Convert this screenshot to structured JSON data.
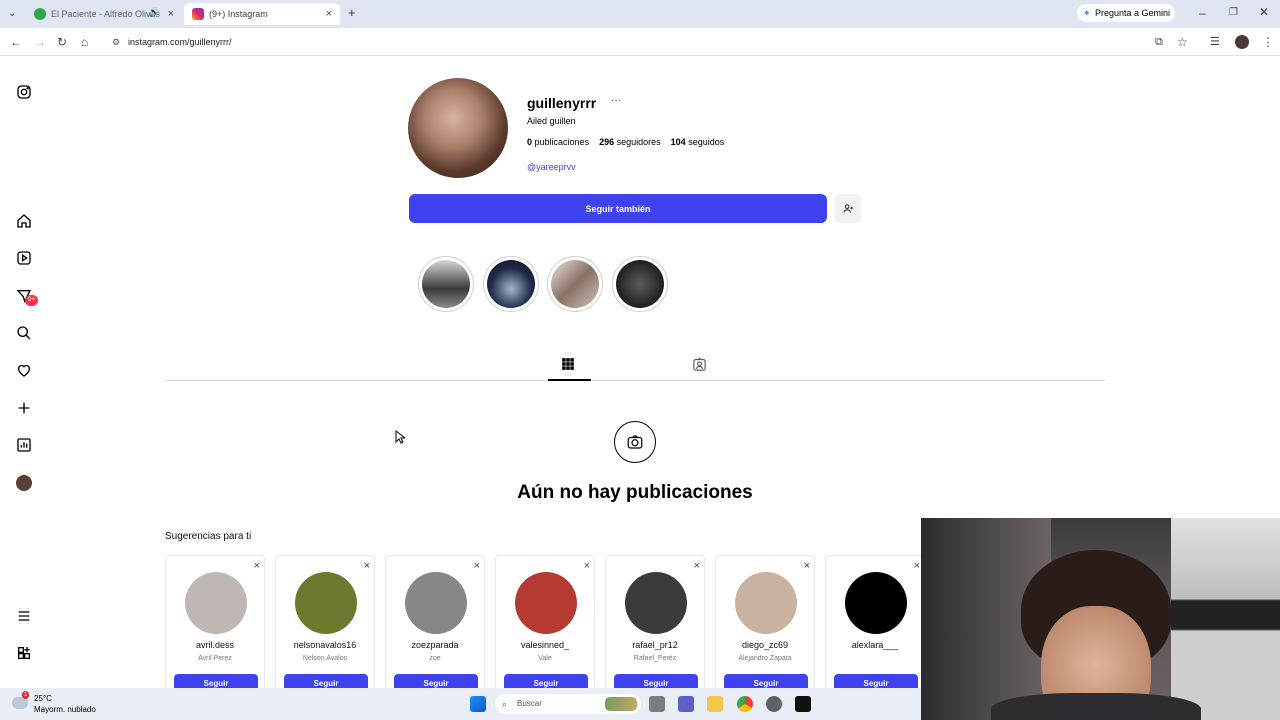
{
  "browser": {
    "tabs": [
      {
        "title": "El Paciente - Alfredo Olivas",
        "active": false
      },
      {
        "title": "(9+) Instagram",
        "active": true
      }
    ],
    "gemini_label": "Pregunta a Gemini",
    "url": "instagram.com/guillenyrrr/"
  },
  "nav": {
    "notification_badge": "9+"
  },
  "profile": {
    "username": "guillenyrrr",
    "more_glyph": "···",
    "full_name": "Ailed guillen",
    "posts_count": "0",
    "posts_label": "publicaciones",
    "followers_count": "296",
    "followers_label": "seguidores",
    "following_count": "104",
    "following_label": "seguidos",
    "mention": "@yareeprvv",
    "follow_button": "Seguir también"
  },
  "empty_state": {
    "title": "Aún no hay publicaciones"
  },
  "suggestions": {
    "title": "Sugerencias para ti",
    "button_label": "Seguir",
    "items": [
      {
        "username": "avril.dess",
        "name": "Avril Perez",
        "color": "#bfb7b4"
      },
      {
        "username": "nelsonavalos16",
        "name": "Nelson Avalos",
        "color": "#6a7a2e"
      },
      {
        "username": "zoezparada",
        "name": "zoe",
        "color": "#8a8684"
      },
      {
        "username": "valesinned_",
        "name": "Vale",
        "color": "#b53a32"
      },
      {
        "username": "rafael_pr12",
        "name": "Rafael_Peréz",
        "color": "#3a3b3c"
      },
      {
        "username": "diego_zc69",
        "name": "Alejandro Zapata",
        "color": "#c9b3a0"
      },
      {
        "username": "alexlara___",
        "name": "",
        "color": "#000000"
      }
    ]
  },
  "taskbar": {
    "weather_temp": "25°C",
    "weather_desc": "Mayorm. nublado",
    "search_placeholder": "Buscar",
    "weather_badge": "1"
  }
}
